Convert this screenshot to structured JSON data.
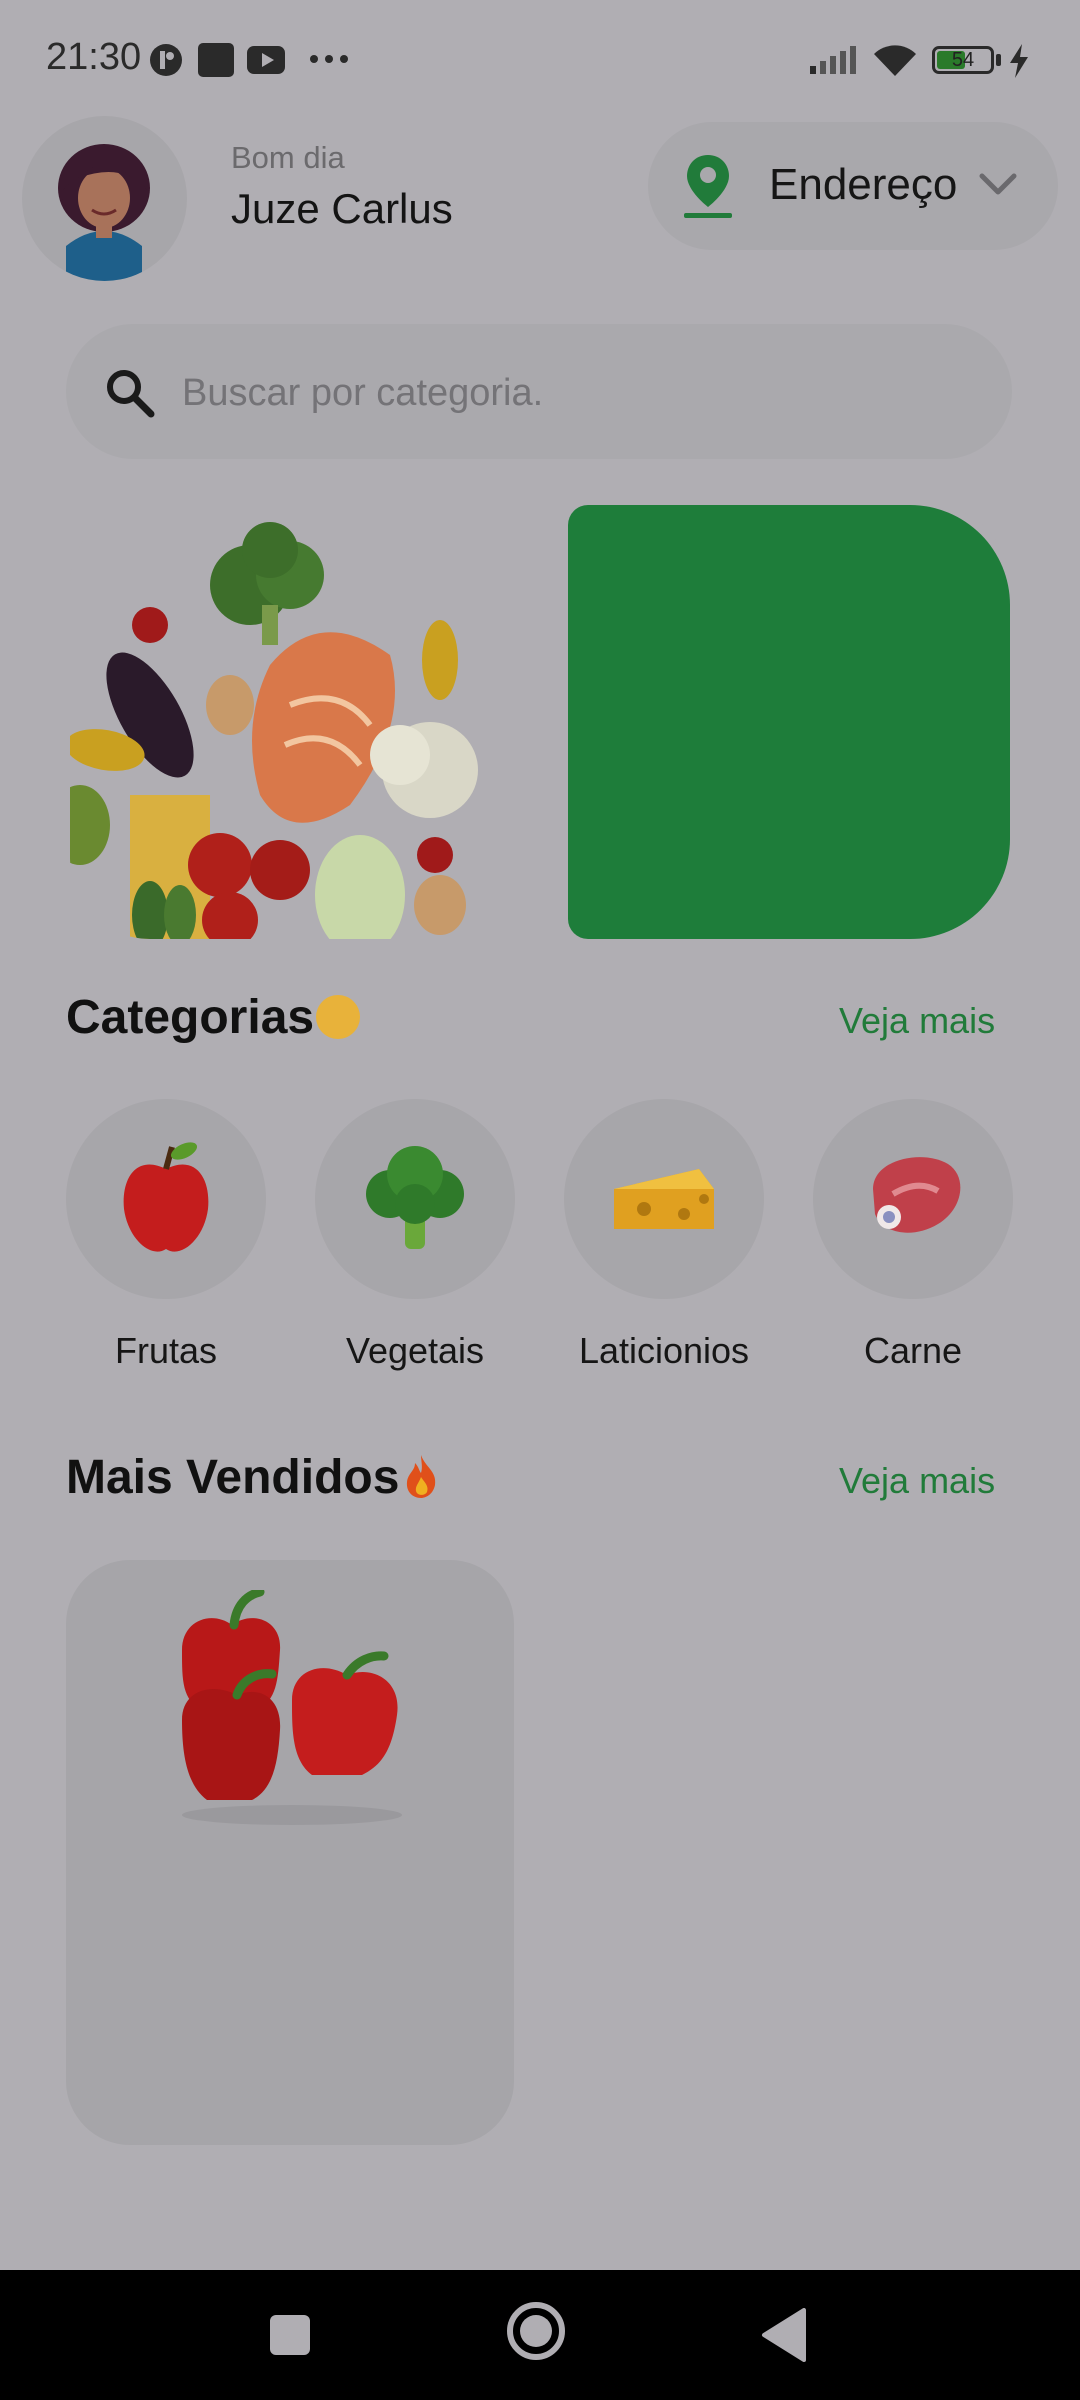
{
  "status_bar": {
    "time": "21:30",
    "battery": "54",
    "battery_level": 0.54,
    "icons": [
      "app-icon",
      "square-app-icon",
      "youtube-icon",
      "more-dots-icon",
      "signal-icon",
      "wifi-icon",
      "battery-icon",
      "charging-icon"
    ]
  },
  "header": {
    "greeting": "Bom dia",
    "username": "Juze Carlus",
    "address_label": "Endereço"
  },
  "search": {
    "placeholder": "Buscar por categoria."
  },
  "categories": {
    "title": "Categorias",
    "see_more": "Veja mais",
    "items": [
      {
        "label": "Frutas",
        "icon": "apple-icon"
      },
      {
        "label": "Vegetais",
        "icon": "broccoli-icon"
      },
      {
        "label": "Laticionios",
        "icon": "cheese-icon"
      },
      {
        "label": "Carne",
        "icon": "meat-icon"
      }
    ]
  },
  "best_sellers": {
    "title": "Mais Vendidos",
    "see_more": "Veja mais",
    "products": [
      {
        "image": "red-peppers-image"
      }
    ]
  },
  "colors": {
    "accent_green": "#217b3a",
    "banner_green": "#1e7d3a",
    "overlay_background": "#b0aeb3",
    "nav_bar": "#000000"
  },
  "nav": {
    "icons": [
      "recents-icon",
      "home-icon",
      "back-icon"
    ]
  }
}
